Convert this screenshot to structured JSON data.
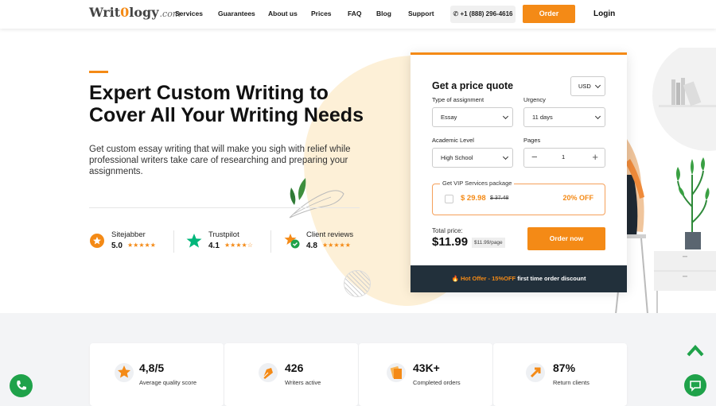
{
  "header": {
    "logo": {
      "text_a": "Writ",
      "text_b": "0",
      "text_c": "logy",
      "text_d": ".com"
    },
    "nav": [
      "Services",
      "Guarantees",
      "About us",
      "Prices",
      "FAQ",
      "Blog",
      "Support"
    ],
    "phone": "+1 (888) 296-4616",
    "order_label": "Order",
    "login_label": "Login"
  },
  "hero": {
    "title": "Expert Custom Writing to Cover All Your Writing Needs",
    "subtitle": "Get custom essay writing that will make you sigh with relief while professional writers take care of researching and preparing your assignments.",
    "reviews": [
      {
        "name": "Sitejabber",
        "score": "5.0",
        "stars": "★★★★★"
      },
      {
        "name": "Trustpilot",
        "score": "4.1",
        "stars": "★★★★☆"
      },
      {
        "name": "Client reviews",
        "score": "4.8",
        "stars": "★★★★★"
      }
    ]
  },
  "quote": {
    "title": "Get a price quote",
    "currency": "USD",
    "assignment_label": "Type of assignment",
    "assignment_value": "Essay",
    "urgency_label": "Urgency",
    "urgency_value": "11 days",
    "level_label": "Academic Level",
    "level_value": "High School",
    "pages_label": "Pages",
    "pages_value": "1",
    "vip_label": "Get VIP Services package",
    "vip_price": "$ 29.98",
    "vip_old_price": "$ 37.48",
    "vip_discount": "20% OFF",
    "total_label": "Total price:",
    "total_value": "$11.99",
    "per_page": "$11.99/page",
    "order_now_label": "Order now",
    "hot_offer": "Hot Offer - 15%OFF",
    "hot_offer_rest": "first time order discount"
  },
  "stats": [
    {
      "value": "4,8/5",
      "label": "Average quality score"
    },
    {
      "value": "426",
      "label": "Writers active"
    },
    {
      "value": "43K+",
      "label": "Completed orders"
    },
    {
      "value": "87%",
      "label": "Return clients"
    }
  ],
  "colors": {
    "accent": "#f48a16",
    "dark": "#22303b",
    "green": "#1fa24a",
    "star_orange": "#f48a16",
    "star_green": "#00b67a"
  }
}
